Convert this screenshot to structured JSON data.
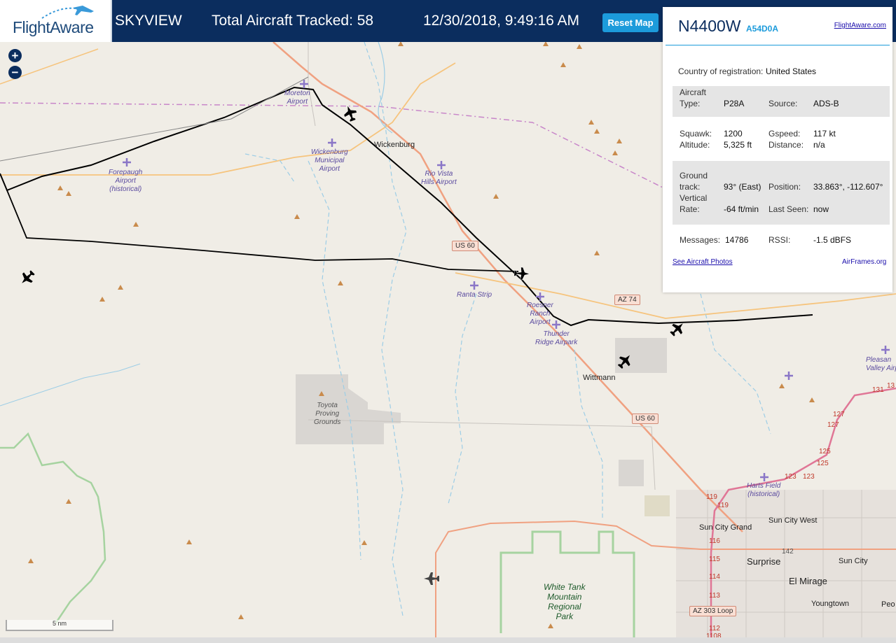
{
  "header": {
    "logo_text": "FlightAware",
    "title": "SKYVIEW",
    "total_tracked": "Total Aircraft Tracked: 58",
    "datetime": "12/30/2018, 9:49:16 AM",
    "reset_label": "Reset Map"
  },
  "map_controls": {
    "zoom_in": "+",
    "zoom_out": "−",
    "scale_label": "5 nm"
  },
  "panel": {
    "tail": "N4400W",
    "hex": "A54D0A",
    "fa_link": "FlightAware.com",
    "country_label": "Country of registration:",
    "country": "United States",
    "aircraft_type_label": "Aircraft Type:",
    "aircraft_type": "P28A",
    "source_label": "Source:",
    "source": "ADS-B",
    "squawk_label": "Squawk:",
    "squawk": "1200",
    "gspeed_label": "Gspeed:",
    "gspeed": "117 kt",
    "altitude_label": "Altitude:",
    "altitude": "5,325 ft",
    "distance_label": "Distance:",
    "distance": "n/a",
    "ground_track_label": "Ground track:",
    "ground_track": "93° (East)",
    "position_label": "Position:",
    "position": "33.863°, -112.607°",
    "vrate_label": "Vertical Rate:",
    "vrate": "-64 ft/min",
    "last_seen_label": "Last Seen:",
    "last_seen": "now",
    "messages_label": "Messages:",
    "messages": "14786",
    "rssi_label": "RSSI:",
    "rssi": "-1.5 dBFS",
    "photos_link": "See Aircraft Photos",
    "airframes_link": "AirFrames.org"
  },
  "map_labels": {
    "moreton": "Moreton\nAirport",
    "wickenburg_muni": "Wickenburg\nMunicipal\nAirport",
    "wickenburg": "Wickenburg",
    "rio_vista": "Rio Vista\nHills Airport",
    "forepaugh": "Forepaugh\nAirport\n(historical)",
    "ranta": "Ranta Strip",
    "roesner": "Roesner\nRanch\nAirport",
    "thunder_ridge": "Thunder\nRidge Airpark",
    "wittmann": "Wittmann",
    "toyota": "Toyota\nProving\nGrounds",
    "harts": "Harts Field\n(historical)",
    "sun_city_grand": "Sun City Grand",
    "sun_city_west": "Sun City West",
    "surprise": "Surprise",
    "sun_city": "Sun City",
    "el_mirage": "El Mirage",
    "youngtown": "Youngtown",
    "pleasant_valley": "Pleasan\nValley Airp",
    "white_tank": "White Tank\nMountain\nRegional\nPark",
    "us60_a": "US 60",
    "us60_b": "US 60",
    "az74": "AZ 74",
    "az303": "AZ 303 Loop",
    "mile_markers": [
      "119",
      "119",
      "116",
      "115",
      "114",
      "113",
      "112",
      "1108",
      "123",
      "123",
      "125",
      "125",
      "127",
      "127",
      "131",
      "13",
      "142",
      "Peo"
    ]
  },
  "colors": {
    "header_bg": "#0b2d5e",
    "accent": "#1c9bdb",
    "map_bg": "#f0ede6",
    "route_line": "#000000"
  }
}
